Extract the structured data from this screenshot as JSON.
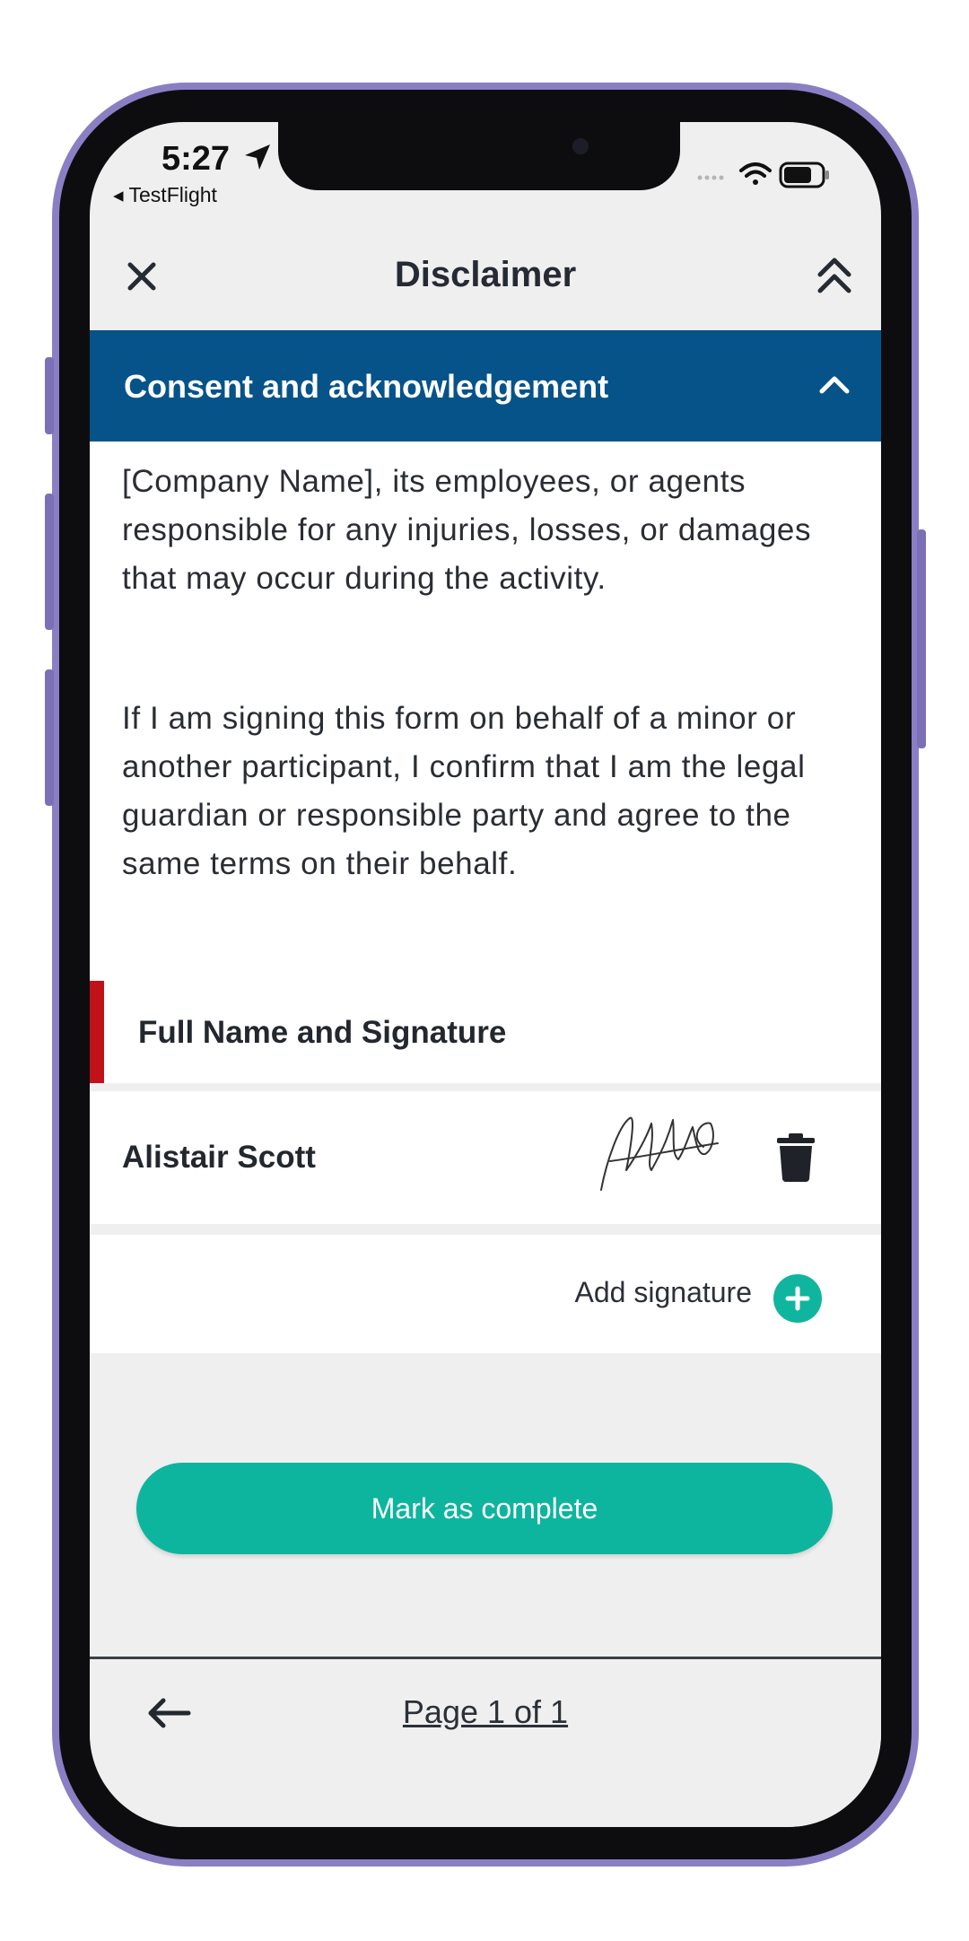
{
  "status_bar": {
    "time": "5:27",
    "back_app": "◂ TestFlight"
  },
  "nav": {
    "title": "Disclaimer"
  },
  "section": {
    "title": "Consent and acknowledgement"
  },
  "content": {
    "paragraphs": [
      "[Company Name], its employees, or agents responsible for any injuries, losses, or damages that may occur during the activity.",
      "If I am signing this form on behalf of a minor or another participant, I confirm that I am the legal guardian or responsible party and agree to the same terms on their behalf."
    ]
  },
  "signature_section": {
    "title": "Full Name and Signature",
    "signer_name": "Alistair Scott",
    "add_label": "Add signature"
  },
  "actions": {
    "complete_label": "Mark as complete"
  },
  "footer": {
    "page_label": "Page 1 of 1"
  },
  "colors": {
    "section_bar": "#06538a",
    "accent_teal": "#0db59f",
    "required_marker": "#c1121a",
    "phone_frame": "#8a7fc4"
  },
  "icons": [
    "close-icon",
    "double-chevron-up-icon",
    "chevron-up-icon",
    "trash-icon",
    "plus-icon",
    "arrow-left-icon",
    "location-arrow-icon",
    "wifi-icon",
    "battery-icon"
  ]
}
